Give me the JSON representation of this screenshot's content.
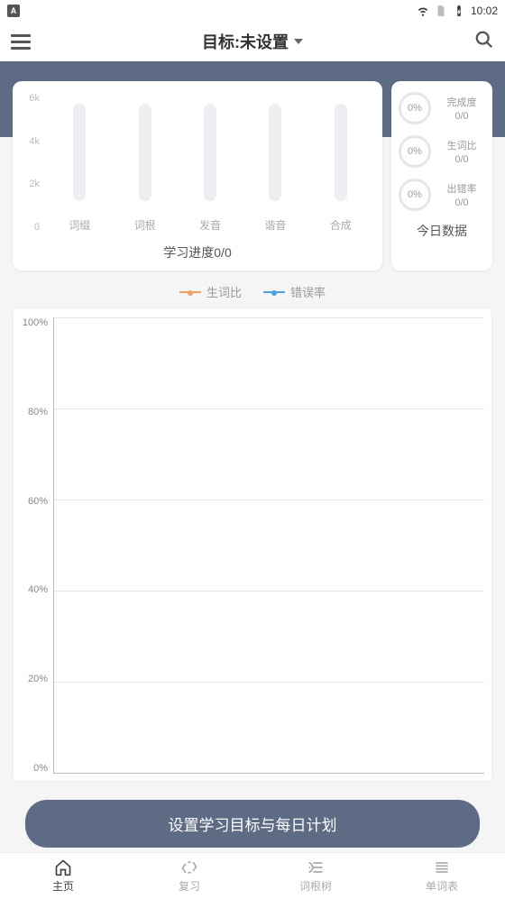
{
  "status": {
    "time": "10:02"
  },
  "header": {
    "title": "目标:未设置"
  },
  "progress": {
    "yticks": [
      "6k",
      "4k",
      "2k",
      "0"
    ],
    "bars": [
      {
        "label": "词缀"
      },
      {
        "label": "词根"
      },
      {
        "label": "发音"
      },
      {
        "label": "谐音"
      },
      {
        "label": "合成"
      }
    ],
    "caption": "学习进度0/0"
  },
  "today": {
    "rows": [
      {
        "pct": "0%",
        "label": "完成度",
        "val": "0/0"
      },
      {
        "pct": "0%",
        "label": "生词比",
        "val": "0/0"
      },
      {
        "pct": "0%",
        "label": "出错率",
        "val": "0/0"
      }
    ],
    "caption": "今日数据"
  },
  "legend": {
    "a": "生词比",
    "b": "错误率"
  },
  "line": {
    "yticks": [
      "100%",
      "80%",
      "60%",
      "40%",
      "20%",
      "0%"
    ]
  },
  "cta": {
    "label": "设置学习目标与每日计划"
  },
  "nav": {
    "items": [
      {
        "label": "主页"
      },
      {
        "label": "复习"
      },
      {
        "label": "词根树"
      },
      {
        "label": "单词表"
      }
    ]
  },
  "chart_data": [
    {
      "type": "bar",
      "title": "学习进度",
      "categories": [
        "词缀",
        "词根",
        "发音",
        "谐音",
        "合成"
      ],
      "values": [
        0,
        0,
        0,
        0,
        0
      ],
      "ylim": [
        0,
        6000
      ],
      "yticks": [
        0,
        2000,
        4000,
        6000
      ]
    },
    {
      "type": "line",
      "title": "生词比 / 错误率",
      "series": [
        {
          "name": "生词比",
          "values": []
        },
        {
          "name": "错误率",
          "values": []
        }
      ],
      "ylabel": "%",
      "ylim": [
        0,
        100
      ],
      "yticks": [
        0,
        20,
        40,
        60,
        80,
        100
      ]
    }
  ]
}
